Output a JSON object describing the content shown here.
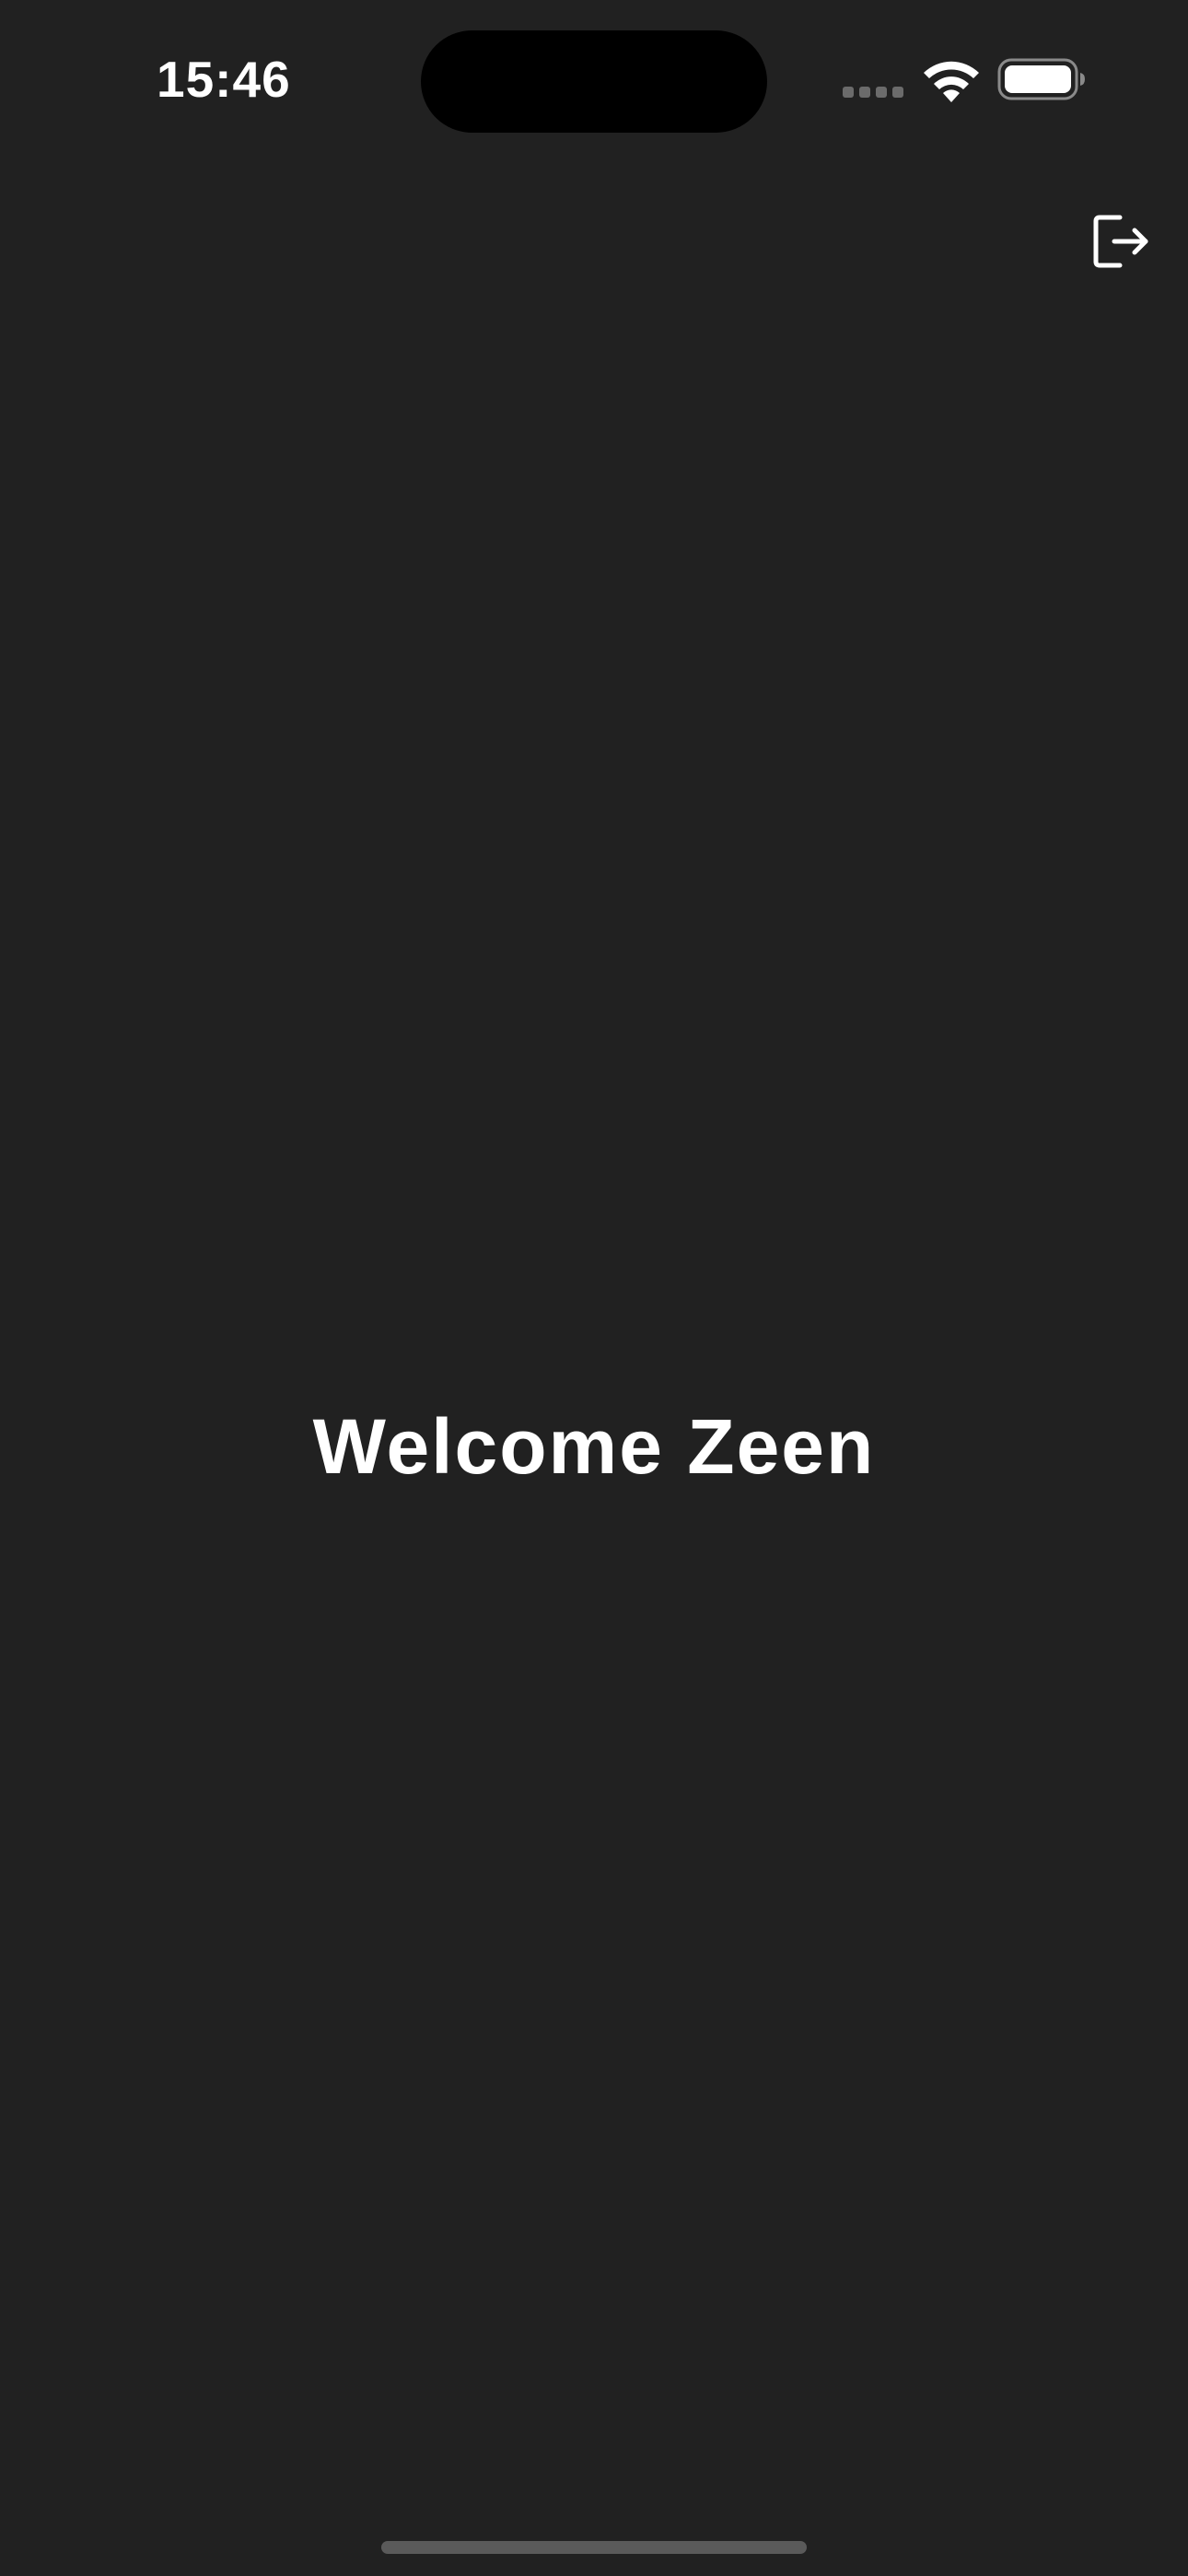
{
  "status_bar": {
    "time": "15:46",
    "signal_icon": "cellular-signal-icon",
    "wifi_icon": "wifi-icon",
    "battery_icon": "battery-icon"
  },
  "header": {
    "logout_icon": "logout-icon"
  },
  "main": {
    "welcome_text": "Welcome Zeen"
  },
  "colors": {
    "background": "#212121",
    "text": "#ffffff",
    "home_indicator": "#5a5a5a"
  }
}
